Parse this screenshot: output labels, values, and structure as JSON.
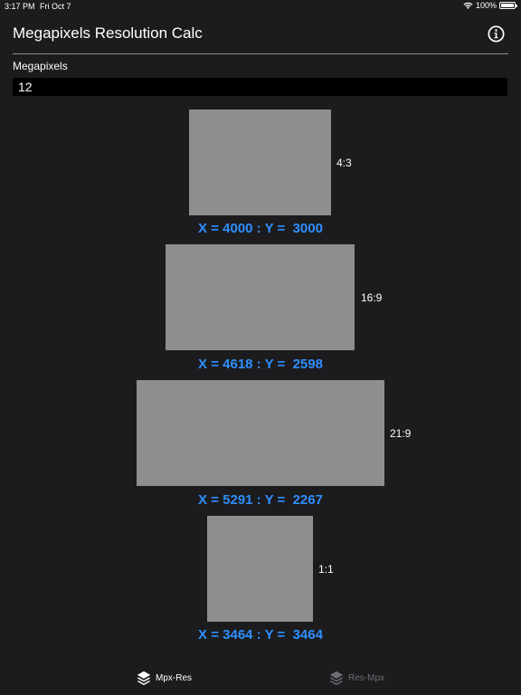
{
  "status_bar": {
    "time": "3:17 PM",
    "date": "Fri Oct 7",
    "battery": "100%",
    "icons": [
      "wifi-icon",
      "battery-icon"
    ]
  },
  "header": {
    "title": "Megapixels Resolution Calc",
    "info_icon": "info-icon"
  },
  "input": {
    "label": "Megapixels",
    "value": "12"
  },
  "ratios": [
    {
      "label": "4:3",
      "result": "X = 4000 : Y =  3000"
    },
    {
      "label": "16:9",
      "result": "X = 4618 : Y =  2598"
    },
    {
      "label": "21:9",
      "result": "X = 5291 : Y =  2267"
    },
    {
      "label": "1:1",
      "result": "X = 3464 : Y =  3464"
    }
  ],
  "tab_bar": {
    "tabs": [
      {
        "label": "Mpx-Res",
        "icon": "layers-icon",
        "active": true
      },
      {
        "label": "Res-Mpx",
        "icon": "layers-icon",
        "active": false
      }
    ]
  },
  "colors": {
    "background": "#1c1c1e",
    "accent": "#2f8fff",
    "preview_rect": "#8e8e8e",
    "input_bg": "#000000"
  }
}
